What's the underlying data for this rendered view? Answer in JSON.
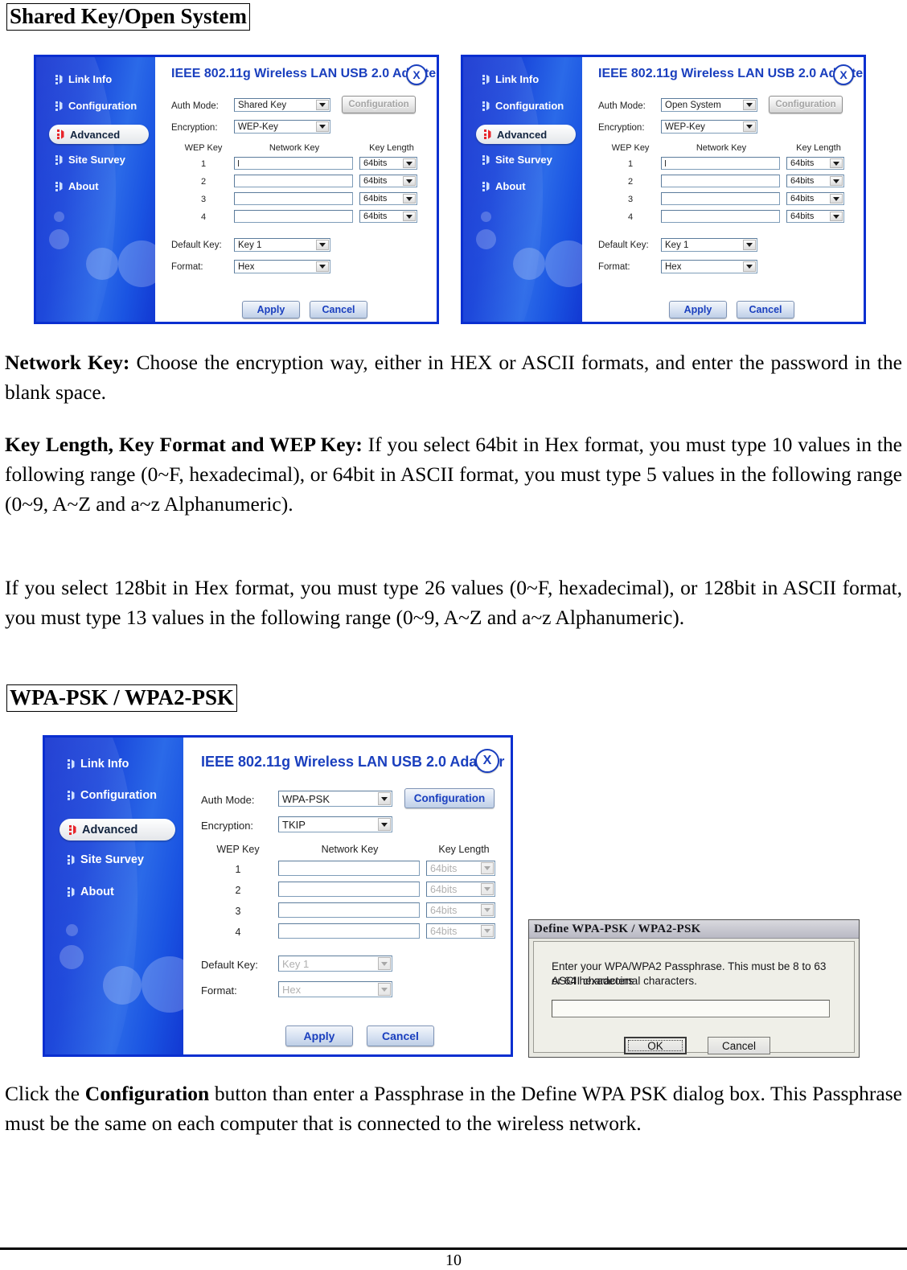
{
  "document": {
    "page_number": "10",
    "sections": [
      {
        "heading": "Shared Key/Open System"
      },
      {
        "heading": "WPA-PSK / WPA2-PSK"
      }
    ],
    "paragraphs": {
      "network_key_label": "Network Key:",
      "network_key_body": " Choose the encryption way, either in HEX or ASCII formats, and enter the password in the blank space.",
      "key_length_label": "Key Length, Key Format and WEP Key:",
      "key_length_body": " If you select 64bit in Hex format, you must type 10 values in the following range (0~F, hexadecimal), or 64bit in ASCII format, you must type 5 values in the following range (0~9, A~Z and a~z Alphanumeric).",
      "bit128_body": "If you select 128bit in Hex format, you must type 26 values (0~F, hexadecimal), or 128bit in ASCII format, you must type 13 values in the following range (0~9, A~Z and a~z Alphanumeric).",
      "click_config_pre": "Click the ",
      "click_config_bold": "Configuration",
      "click_config_post": " button than enter a Passphrase in the Define WPA PSK dialog box. This Passphrase must be the same on each computer that is connected to the wireless network."
    }
  },
  "adapter_window": {
    "title": "IEEE 802.11g Wireless LAN USB 2.0 Adapter",
    "close_label": "X",
    "nav": [
      {
        "label": "Link Info",
        "active": false
      },
      {
        "label": "Configuration",
        "active": false
      },
      {
        "label": "Advanced",
        "active": true
      },
      {
        "label": "Site Survey",
        "active": false
      },
      {
        "label": "About",
        "active": false
      }
    ],
    "labels": {
      "auth_mode": "Auth Mode:",
      "encryption": "Encryption:",
      "wep_key_col": "WEP Key",
      "network_key_col": "Network Key",
      "key_length_col": "Key Length",
      "default_key": "Default Key:",
      "format": "Format:"
    },
    "buttons": {
      "configuration": "Configuration",
      "apply": "Apply",
      "cancel": "Cancel"
    },
    "rows": [
      "1",
      "2",
      "3",
      "4"
    ],
    "key_lengths": [
      "64bits",
      "64bits",
      "64bits",
      "64bits"
    ],
    "default_key_value": "Key 1",
    "format_value": "Hex"
  },
  "screens": {
    "shared_key": {
      "auth_mode_value": "Shared Key",
      "encryption_value": "WEP-Key"
    },
    "open_system": {
      "auth_mode_value": "Open System",
      "encryption_value": "WEP-Key"
    },
    "wpa_psk": {
      "auth_mode_value": "WPA-PSK",
      "encryption_value": "TKIP"
    }
  },
  "define_dialog": {
    "title": "Define WPA-PSK / WPA2-PSK",
    "message_line1": "Enter your WPA/WPA2 Passphrase. This must be 8 to 63 ASCII characters",
    "message_line2": "or 64 hexadecimal characters.",
    "passphrase_value": "",
    "ok_label": "OK",
    "cancel_label": "Cancel"
  },
  "colors": {
    "sidebar_dark": "#0f2fcf",
    "sidebar_light": "#2b6ae8",
    "title_blue": "#1a3fbe",
    "window_border": "#0a2fd0"
  }
}
